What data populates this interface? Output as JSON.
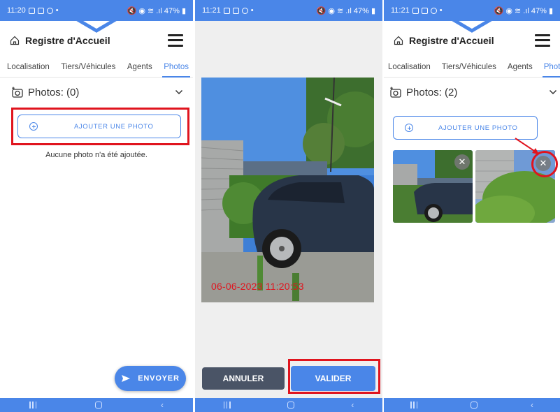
{
  "colors": {
    "accent": "#4a86e8",
    "highlight": "#e0141e",
    "cancel": "#4a5466"
  },
  "screens": [
    {
      "status": {
        "time": "11:20",
        "right": "47%"
      },
      "app_title": "Registre d'Accueil",
      "tabs": [
        "Localisation",
        "Tiers/Véhicules",
        "Agents",
        "Photos"
      ],
      "active_tab": "Photos",
      "section_title": "Photos: (0)",
      "add_label": "AJOUTER UNE PHOTO",
      "empty_text": "Aucune photo n'a été ajoutée.",
      "send_label": "ENVOYER"
    },
    {
      "status": {
        "time": "11:21",
        "right": "47%"
      },
      "timestamp": "06-06-2023 11:20:53",
      "cancel_label": "ANNULER",
      "validate_label": "VALIDER"
    },
    {
      "status": {
        "time": "11:21",
        "right": "47%"
      },
      "app_title": "Registre d'Accueil",
      "tabs": [
        "Localisation",
        "Tiers/Véhicules",
        "Agents",
        "Photos"
      ],
      "active_tab": "Photos",
      "section_title": "Photos: (2)",
      "add_label": "AJOUTER UNE PHOTO",
      "photo_count": 2
    }
  ],
  "icons": {
    "home": "home-icon",
    "menu": "hamburger-menu-icon",
    "camera": "camera-add-icon",
    "chevron": "chevron-down-icon",
    "plus": "plus-circle-icon",
    "send": "send-icon",
    "delete": "close-icon"
  }
}
